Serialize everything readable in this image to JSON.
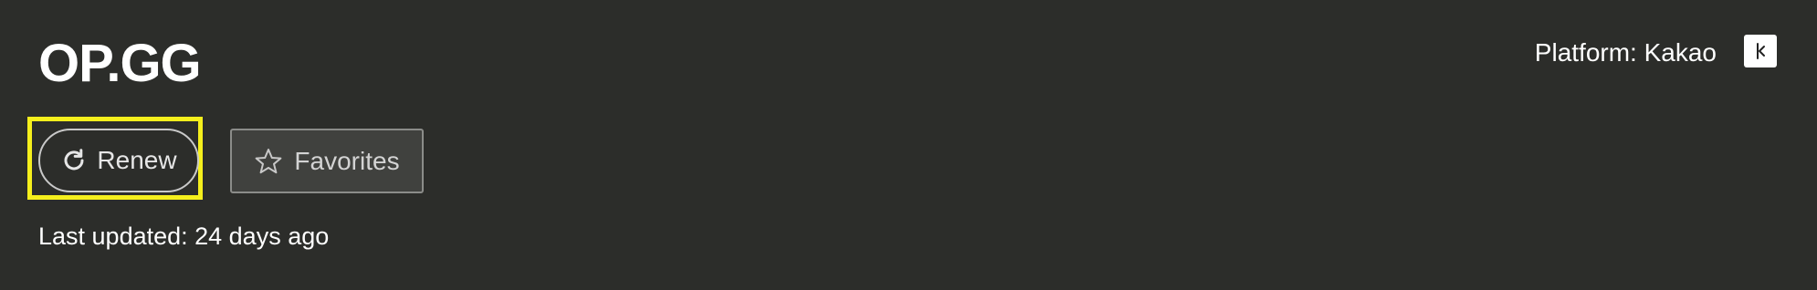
{
  "header": {
    "site_title": "OP.GG",
    "platform_label": "Platform: Kakao",
    "platform_logo_icon": "kakao-logo-icon"
  },
  "actions": {
    "renew": {
      "label": "Renew",
      "icon": "refresh-icon"
    },
    "favorites": {
      "label": "Favorites",
      "icon": "star-outline-icon"
    }
  },
  "status": {
    "last_updated": "Last updated: 24 days ago"
  },
  "colors": {
    "background": "#2c2d2a",
    "highlight": "#f5ef1c",
    "text": "#ffffff"
  }
}
